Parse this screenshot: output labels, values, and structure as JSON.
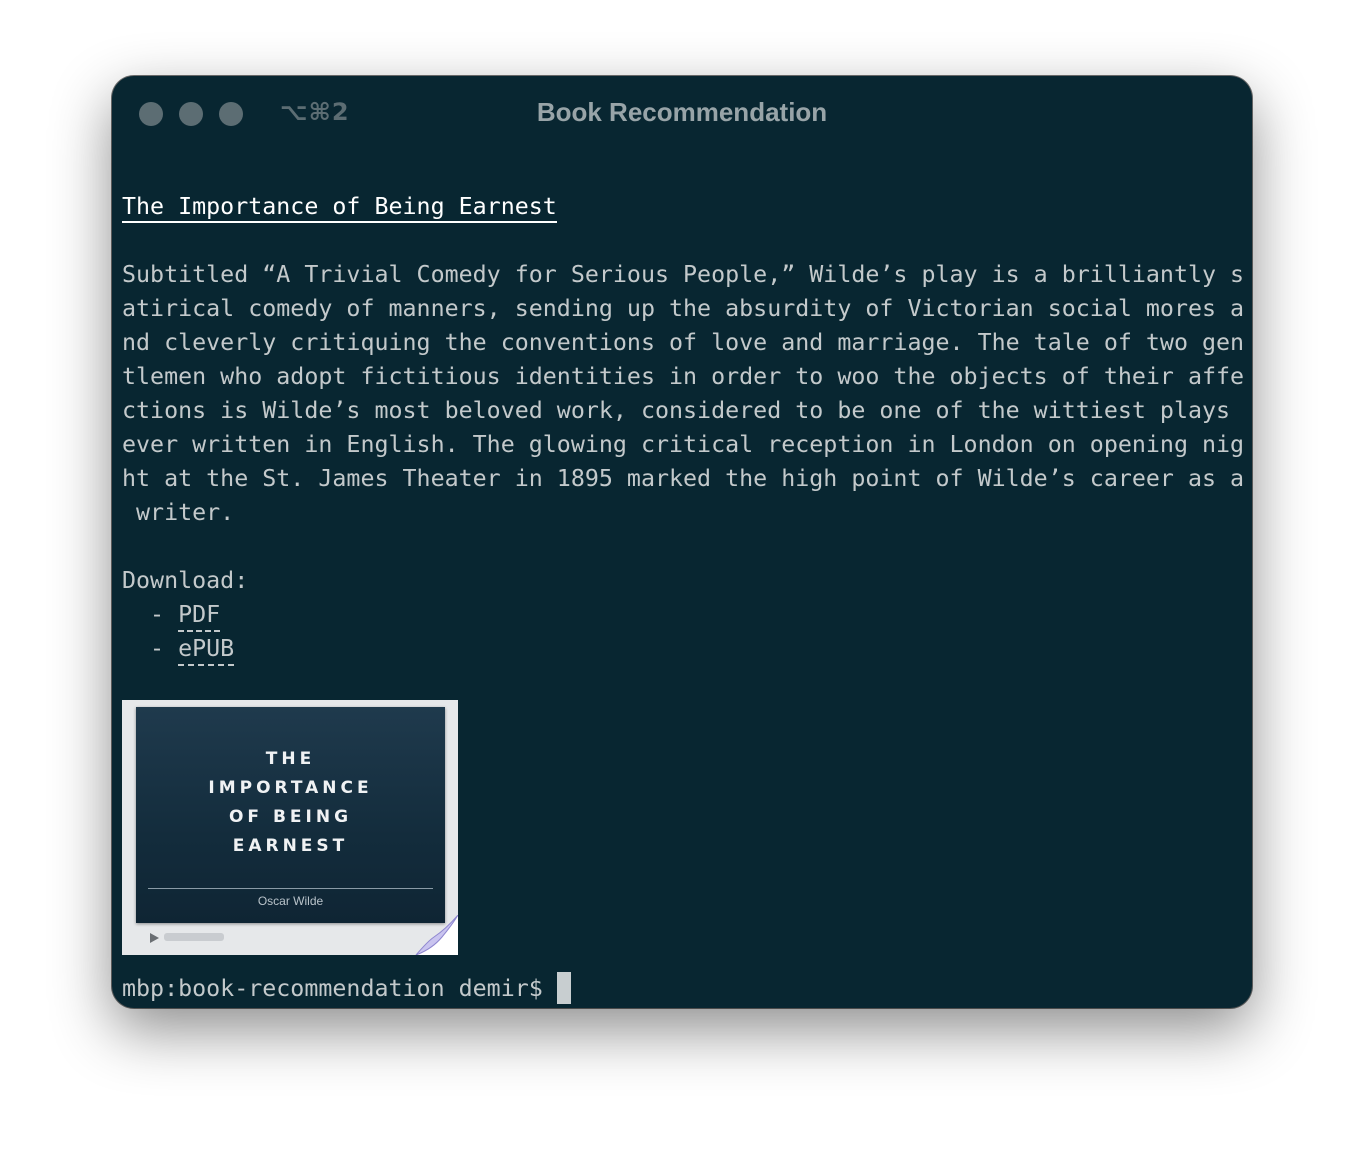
{
  "window": {
    "title": "Book Recommendation",
    "shortcut": "⌥⌘2"
  },
  "book": {
    "title": "The Importance of Being Earnest",
    "description_lines": [
      "Subtitled “A Trivial Comedy for Serious People,” Wilde’s play is a brilliantly s",
      "atirical comedy of manners, sending up the absurdity of Victorian social mores a",
      "nd cleverly critiquing the conventions of love and marriage. The tale of two gen",
      "tlemen who adopt fictitious identities in order to woo the objects of their affe",
      "ctions is Wilde’s most beloved work, considered to be one of the wittiest plays",
      "ever written in English. The glowing critical reception in London on opening nig",
      "ht at the St. James Theater in 1895 marked the high point of Wilde’s career as a",
      " writer."
    ],
    "download_label": "Download:",
    "download_bullet": "  - ",
    "downloads": [
      {
        "label": "PDF"
      },
      {
        "label": "ePUB"
      }
    ],
    "cover": {
      "title_lines": [
        "THE",
        "IMPORTANCE",
        "OF BEING",
        "EARNEST"
      ],
      "author": "Oscar Wilde",
      "background_color": "#132c3c"
    }
  },
  "terminal": {
    "prompt": "mbp:book-recommendation demir$"
  },
  "colors": {
    "window_bg": "#082631",
    "text": "#c3c9cb",
    "title_text": "#98a4a8",
    "traffic_lights": "#5c6d73"
  }
}
